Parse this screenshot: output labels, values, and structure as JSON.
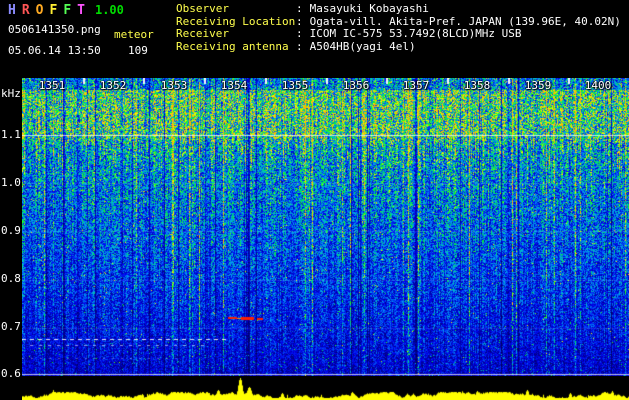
{
  "app": {
    "title_letters": [
      "H",
      "R",
      "O",
      "F",
      "F",
      "T"
    ],
    "title_colors": [
      "#8c8cff",
      "#ff5555",
      "#ffaa22",
      "#ffee33",
      "#55ff55",
      "#ff55ff"
    ],
    "version": "1.00",
    "version_color": "#00dd00"
  },
  "file": {
    "name": "0506141350.png",
    "mode": "meteor",
    "datetime": "05.06.14 13:50",
    "count": "109"
  },
  "info": {
    "colon": ":",
    "rows": [
      {
        "label": "Observer",
        "value": "Masayuki Kobayashi"
      },
      {
        "label": "Receiving Location",
        "value": "Ogata-vill. Akita-Pref. JAPAN (139.96E, 40.02N)"
      },
      {
        "label": "Receiver",
        "value": "ICOM IC-575 53.7492(8LCD)MHz USB"
      },
      {
        "label": "Receiving antenna",
        "value": "A504HB(yagi 4el)"
      }
    ]
  },
  "spectrogram": {
    "unit_label": "kHz",
    "freq_labels": [
      "1.1",
      "1.0",
      "0.9",
      "0.8",
      "0.7",
      "0.6"
    ],
    "time_labels": [
      "1351",
      "1352",
      "1353",
      "1354",
      "1355",
      "1356",
      "1357",
      "1358",
      "1359",
      "1400"
    ],
    "description": "radio meteor observation spectrogram 13:50-14:00, meteor echo near 1354 at ~0.72 kHz",
    "echo_color": "#ff1e00",
    "amplitude_color": "#ffff00"
  }
}
